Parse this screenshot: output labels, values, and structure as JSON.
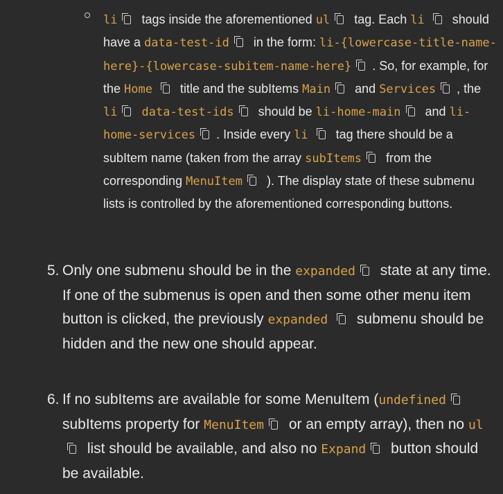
{
  "sub": {
    "p1a": "li",
    "p1b": "tags inside the aforementioned",
    "p1c": "ul",
    "p1d": "tag. Each",
    "p1e": "li",
    "p2a": "should have a",
    "p2b": "data-test-id",
    "p2c": "in the form:",
    "p2d": "li-{lowercase-title-name-here}-{lowercase-subitem-name-here}",
    "p3a": ". So, for example, for the",
    "p3b": "Home",
    "p3c": "title and the subItems",
    "p3d": "Main",
    "p3e": "and",
    "p3f": "Services",
    "p3g": ",",
    "p4a": "the",
    "p4b": "li",
    "p4c": "data-test-ids",
    "p4d": "should be",
    "p4e": "li-home-main",
    "p4f": "and",
    "p4g": "li-home-services",
    "p4h": ". Inside every",
    "p4i": "li",
    "p5a": "tag there should be a subItem name (taken from the array",
    "p5b": "subItems",
    "p5c": "from the corresponding",
    "p5d": "MenuItem",
    "p5e": "). The display state of these submenu lists is controlled by the aforementioned corresponding buttons."
  },
  "item5": {
    "num": "5.",
    "a": "Only one submenu should be in the",
    "b": "expanded",
    "c": "state at any time. If one of the submenus is open and then some other menu item button is clicked, the previously",
    "d": "expanded",
    "e": "submenu should be hidden and the new one should appear."
  },
  "item6": {
    "num": "6.",
    "a": "If no subItems are available for some MenuItem (",
    "b": "undefined",
    "c": "subItems property for",
    "d": "MenuItem",
    "e": "or an empty array), then no",
    "f": "ul",
    "g": "list should be available, and also no",
    "h": "Expand",
    "i": "button should be available."
  }
}
